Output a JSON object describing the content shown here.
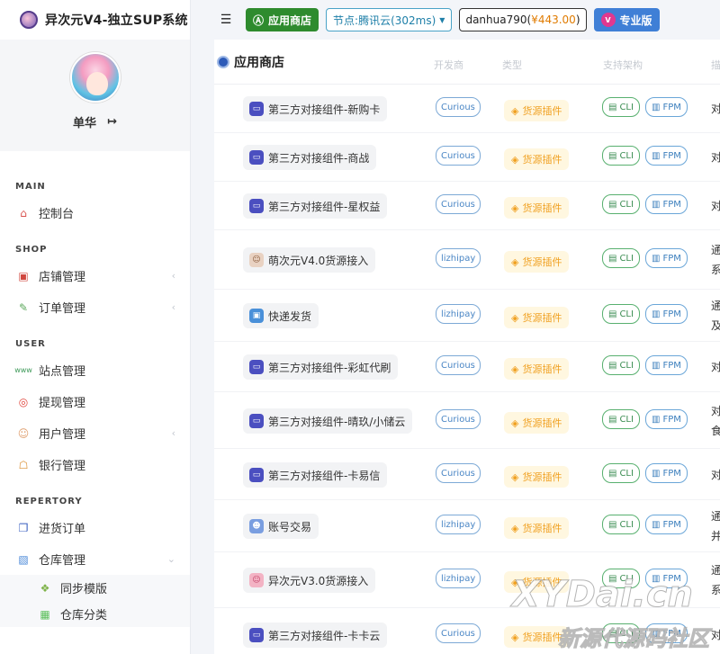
{
  "app": {
    "title": "异次元V4-独立SUP系统"
  },
  "profile": {
    "username": "单华"
  },
  "sidebar": {
    "sections": [
      {
        "heading": "MAIN",
        "items": [
          {
            "label": "控制台"
          }
        ]
      },
      {
        "heading": "SHOP",
        "items": [
          {
            "label": "店铺管理"
          },
          {
            "label": "订单管理"
          }
        ]
      },
      {
        "heading": "USER",
        "items": [
          {
            "label": "站点管理"
          },
          {
            "label": "提现管理"
          },
          {
            "label": "用户管理"
          },
          {
            "label": "银行管理"
          }
        ]
      },
      {
        "heading": "REPERTORY",
        "items": [
          {
            "label": "进货订单"
          },
          {
            "label": "仓库管理"
          }
        ]
      }
    ],
    "submenu": [
      {
        "label": "同步模版"
      },
      {
        "label": "仓库分类"
      }
    ]
  },
  "topbar": {
    "store_label": "应用商店",
    "node_label": "节点:腾讯云(302ms)",
    "user_name": "danhua790(",
    "user_balance": "¥443.00",
    "user_close": ")",
    "pro_label": "专业版"
  },
  "main": {
    "title": "应用商店",
    "columns": [
      "开发商",
      "类型",
      "支持架构",
      "描"
    ],
    "arch_labels": [
      "CLI",
      "FPM"
    ],
    "rows": [
      {
        "name": "第三方对接组件-新购卡",
        "developer": "Curious",
        "type": "货源插件",
        "desc": "对"
      },
      {
        "name": "第三方对接组件-商战",
        "developer": "Curious",
        "type": "货源插件",
        "desc": "对"
      },
      {
        "name": "第三方对接组件-星权益",
        "developer": "Curious",
        "type": "货源插件",
        "desc": "对"
      },
      {
        "name": "萌次元V4.0货源接入",
        "developer": "lizhipay",
        "type": "货源插件",
        "desc": "通\n系"
      },
      {
        "name": "快递发货",
        "developer": "lizhipay",
        "type": "货源插件",
        "desc": "通\n及"
      },
      {
        "name": "第三方对接组件-彩虹代刷",
        "developer": "Curious",
        "type": "货源插件",
        "desc": "对"
      },
      {
        "name": "第三方对接组件-晴玖/小储云",
        "developer": "Curious",
        "type": "货源插件",
        "desc": "对\n食"
      },
      {
        "name": "第三方对接组件-卡易信",
        "developer": "Curious",
        "type": "货源插件",
        "desc": "对"
      },
      {
        "name": "账号交易",
        "developer": "lizhipay",
        "type": "货源插件",
        "desc": "通\n并"
      },
      {
        "name": "异次元V3.0货源接入",
        "developer": "lizhipay",
        "type": "货源插件",
        "desc": "通\n系"
      },
      {
        "name": "第三方对接组件-卡卡云",
        "developer": "Curious",
        "type": "货源插件",
        "desc": "对"
      }
    ]
  },
  "watermark": {
    "line1": "XYDai.cn",
    "line2": "新源代源码社区"
  }
}
